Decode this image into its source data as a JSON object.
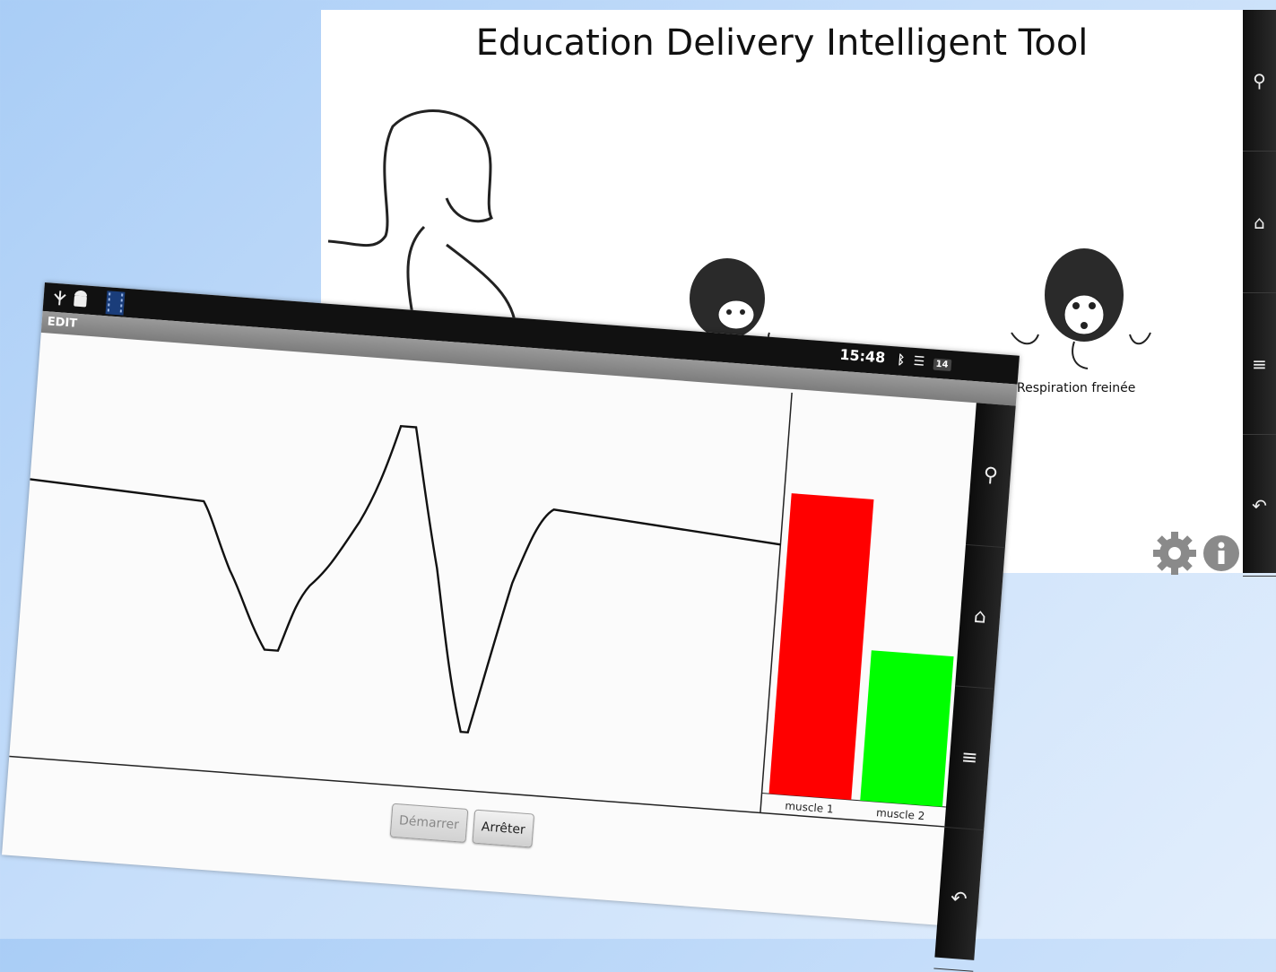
{
  "back_window": {
    "title": "Education Delivery Intelligent Tool",
    "caption": "Respiration freinée",
    "nav_icons": [
      "search-icon",
      "home-icon",
      "menu-icon",
      "back-icon"
    ],
    "tool_icons": [
      "gear-icon",
      "info-icon"
    ]
  },
  "front_window": {
    "app_title": "EDIT",
    "status": {
      "time": "15:48",
      "battery": "14"
    },
    "nav_icons": [
      "search-icon",
      "home-icon",
      "menu-icon",
      "back-icon"
    ],
    "buttons": {
      "start": "Démarrer",
      "stop": "Arrêter"
    },
    "bar_chart": {
      "categories": [
        "muscle 1",
        "muscle 2"
      ],
      "values": [
        0.8,
        0.4
      ],
      "colors": [
        "#ff0000",
        "#00ff00"
      ]
    }
  }
}
